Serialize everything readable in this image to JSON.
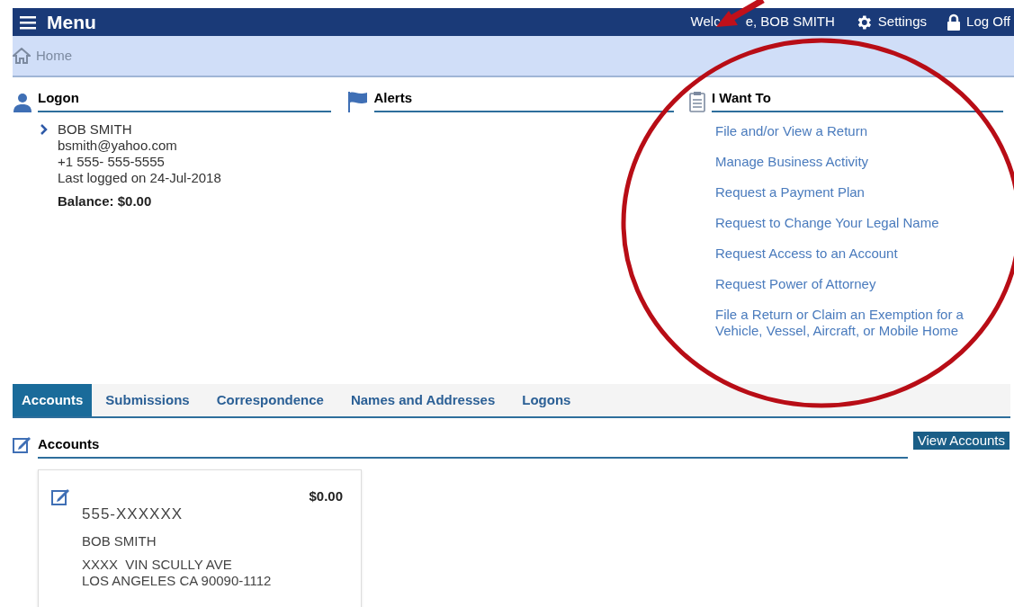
{
  "header": {
    "menu_label": "Menu",
    "welcome_parts": [
      "Welc",
      "e, BOB SMITH"
    ],
    "settings": "Settings",
    "logoff": "Log Off"
  },
  "breadcrumb": "Home",
  "logon": {
    "title": "Logon",
    "name": "BOB SMITH",
    "email": "bsmith@yahoo.com",
    "phone": "+1 555- 555-5555",
    "last_logged": "Last logged on 24-Jul-2018",
    "balance": "Balance: $0.00"
  },
  "alerts": {
    "title": "Alerts"
  },
  "i_want_to": {
    "title": "I Want To",
    "links": [
      "File and/or View a Return",
      "Manage Business Activity",
      "Request a Payment Plan",
      "Request to Change Your Legal Name",
      "Request Access to an Account",
      "Request Power of Attorney",
      "File a Return or Claim an Exemption for a Vehicle, Vessel, Aircraft, or Mobile Home"
    ]
  },
  "tabs": [
    {
      "label": "Accounts",
      "selected": true
    },
    {
      "label": "Submissions",
      "selected": false
    },
    {
      "label": "Correspondence",
      "selected": false
    },
    {
      "label": "Names and Addresses",
      "selected": false
    },
    {
      "label": "Logons",
      "selected": false
    }
  ],
  "accounts": {
    "title": "Accounts",
    "button": "View Accounts",
    "cards": [
      {
        "amount": "$0.00",
        "number": "555-XXXXXX",
        "name": "BOB SMITH",
        "address_lines": [
          "XXXX  VIN SCULLY AVE",
          "LOS ANGELES CA 90090-1112"
        ]
      }
    ]
  }
}
